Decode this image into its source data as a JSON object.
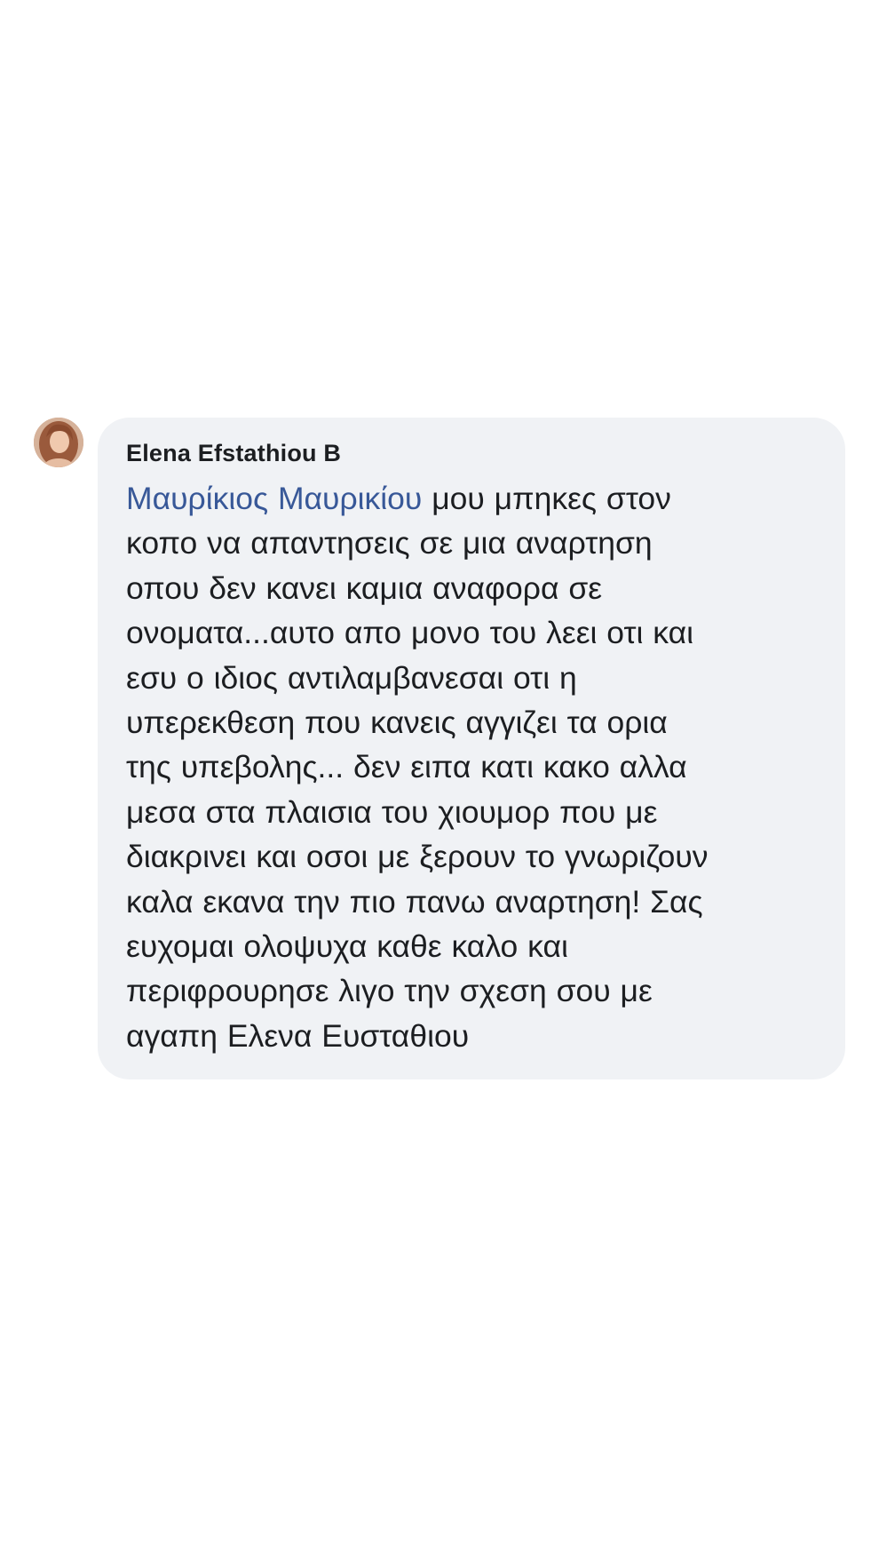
{
  "comment": {
    "author": "Elena Efstathiou B",
    "avatar_icon": "profile-photo-avatar",
    "mention": "Μαυρίκιος Μαυρικίου",
    "text_after_mention": " μου μπηκες στον\nκοπο να απαντησεις σε μια αναρτηση\nοπου δεν κανει καμια αναφορα σε\nονοματα...αυτο απο μονο του λεει οτι και\nεσυ ο ιδιος αντιλαμβανεσαι οτι η\nυπερεκθεση που κανεις αγγιζει τα ορια\nτης υπεβολης... δεν ειπα κατι κακο αλλα\nμεσα στα πλαισια του χιουμορ που με\nδιακρινει και οσοι με ξερουν το γνωριζουν\nκαλα εκανα την πιο πανω αναρτηση! Σας\nευχομαι ολοψυχα καθε καλο και\nπεριφρουρησε λιγο την σχεση σου με\nαγαπη Ελενα Ευσταθιου",
    "colors": {
      "bubble_background": "#f0f2f5",
      "mention_link": "#385898",
      "text": "#1c1e21"
    }
  }
}
